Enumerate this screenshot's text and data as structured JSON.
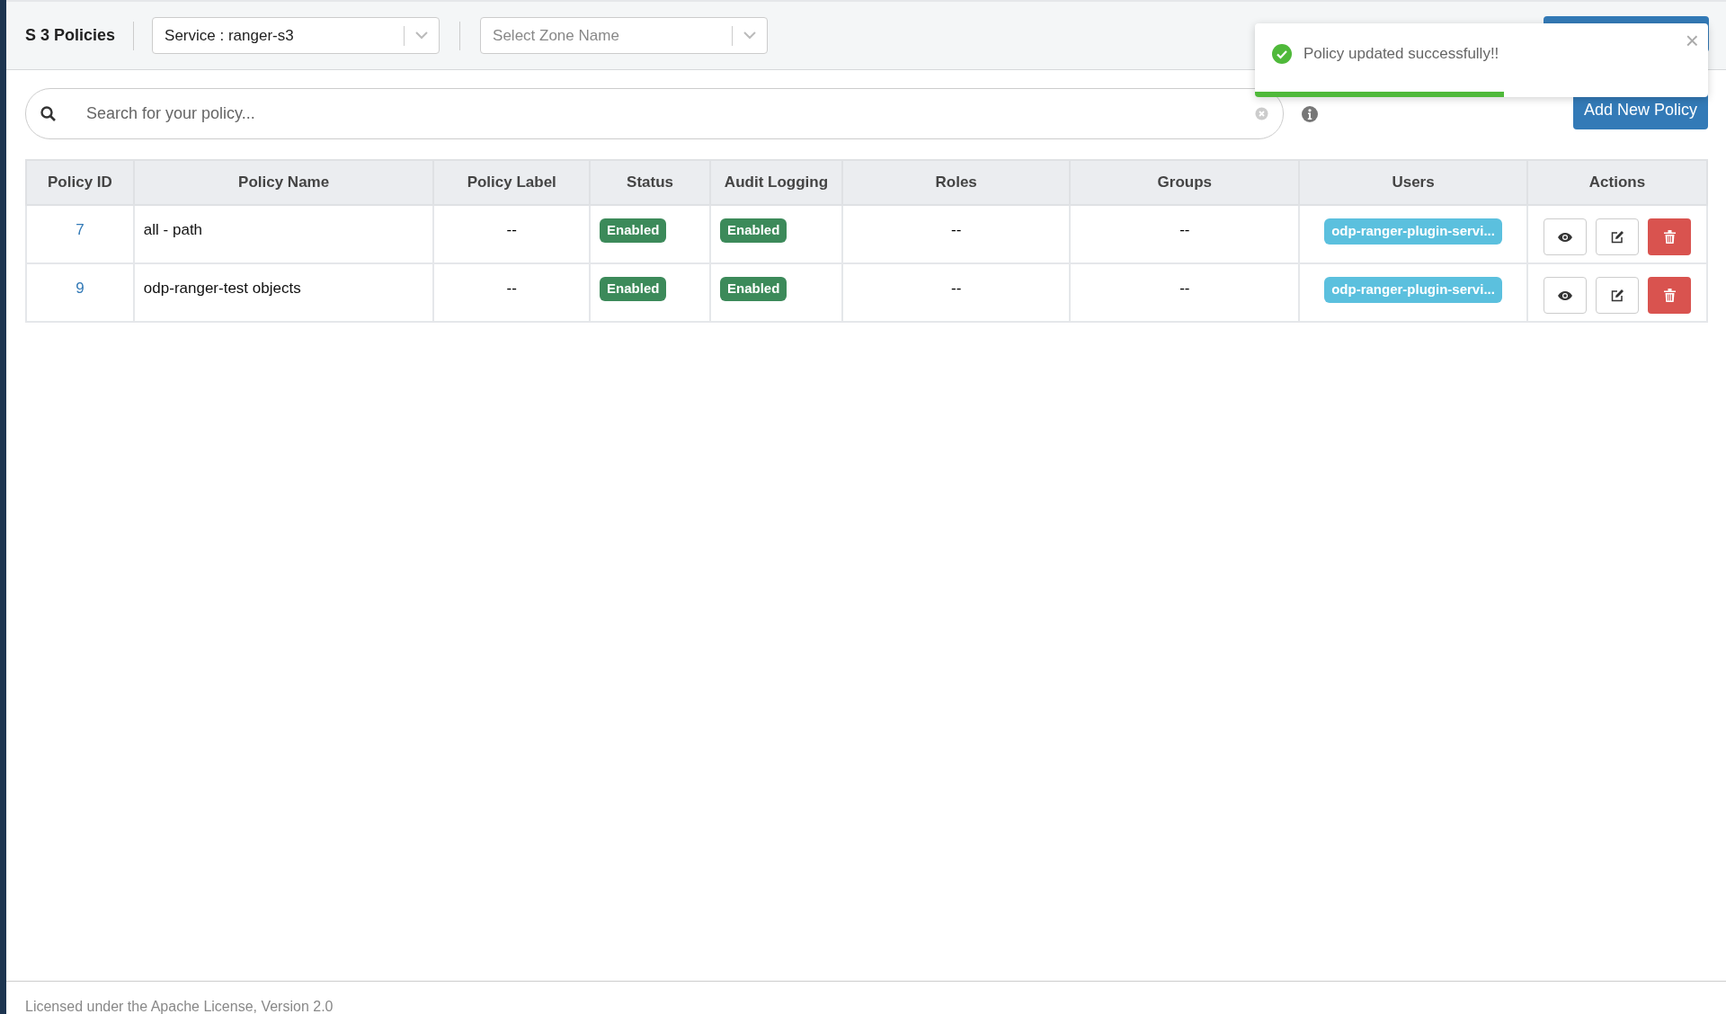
{
  "header": {
    "title": "S 3 Policies",
    "service_select": {
      "value": "Service : ranger-s3"
    },
    "zone_select": {
      "placeholder": "Select Zone Name"
    }
  },
  "toast": {
    "message": "Policy updated successfully!!",
    "close": "×",
    "level": 0.55
  },
  "search": {
    "placeholder": "Search for your policy..."
  },
  "add_button": "Add New Policy",
  "table": {
    "columns": [
      "Policy ID",
      "Policy Name",
      "Policy Label",
      "Status",
      "Audit Logging",
      "Roles",
      "Groups",
      "Users",
      "Actions"
    ],
    "rows": [
      {
        "id": "7",
        "name": "all - path",
        "label": "--",
        "status": "Enabled",
        "audit": "Enabled",
        "roles": "--",
        "groups": "--",
        "users": [
          "odp-ranger-plugin-servi..."
        ]
      },
      {
        "id": "9",
        "name": "odp-ranger-test objects",
        "label": "--",
        "status": "Enabled",
        "audit": "Enabled",
        "roles": "--",
        "groups": "--",
        "users": [
          "odp-ranger-plugin-servi..."
        ]
      }
    ]
  },
  "footer": "Licensed under the Apache License, Version 2.0"
}
